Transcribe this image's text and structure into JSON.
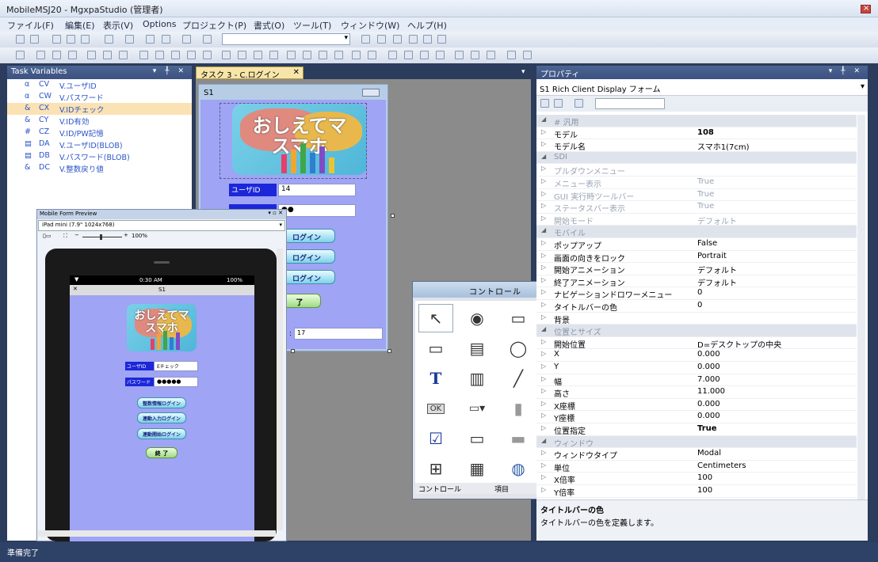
{
  "window": {
    "title": "MobileMSJ20 - MgxpaStudio (管理者)",
    "close": "×"
  },
  "menu": [
    "ファイル(F)",
    "編集(E)",
    "表示(V)",
    "Options",
    "プロジェクト(P)",
    "書式(O)",
    "ツール(T)",
    "ウィンドウ(W)",
    "ヘルプ(H)"
  ],
  "status": "準備完了",
  "task_vars": {
    "title": "Task Variables",
    "controls": "▾ ╀ ✕",
    "rows": [
      {
        "icon": "α",
        "id": "CV",
        "name": "V.ユーザID"
      },
      {
        "icon": "α",
        "id": "CW",
        "name": "V.パスワード"
      },
      {
        "icon": "&",
        "id": "CX",
        "name": "V.IDチェック",
        "selected": true
      },
      {
        "icon": "&",
        "id": "CY",
        "name": "V.ID有効"
      },
      {
        "icon": "#",
        "id": "CZ",
        "name": "V.ID/PW記憶"
      },
      {
        "icon": "▤",
        "id": "DA",
        "name": "V.ユーザID(BLOB)"
      },
      {
        "icon": "▤",
        "id": "DB",
        "name": "V.パスワード(BLOB)"
      },
      {
        "icon": "&",
        "id": "DC",
        "name": "V.整数戻り値"
      }
    ]
  },
  "doc_tab": {
    "label": "タスク 3 - C.ログイン",
    "close": "✕"
  },
  "form": {
    "caption": "S1",
    "logo_l1": "おしえてマ",
    "logo_l2": "スマホ",
    "user_label": "ユーザID",
    "user_value": "14",
    "pass_mask": "●●",
    "btn1": "ログイン",
    "btn2": "ログイン",
    "btn3": "ログイン",
    "btn_exit": "了",
    "bottom_value": "17",
    "bottom_prefix": ":"
  },
  "preview": {
    "title": "Mobile Form Preview",
    "device": "iPad mini (7.9\" 1024x768)",
    "zoom": "100%",
    "time": "0:30 AM",
    "battery": "100%",
    "caption": "S1",
    "close": "✕",
    "user_label": "ユーザID",
    "user_value": "Eチェック",
    "pass_label": "パスワード",
    "pass_value": "●●●●●",
    "btn1": "整数情報ログイン",
    "btn2": "連動入力ログイン",
    "btn3": "連動開始ログイン",
    "btn_exit": "終 了"
  },
  "props": {
    "title": "プロパティ",
    "controls": "▾ ╀ ✕",
    "object": "S1 Rich Client Display フォーム",
    "rows": [
      {
        "k": "# 汎用",
        "v": "",
        "cat": true
      },
      {
        "k": "モデル",
        "v": "108",
        "bold": true
      },
      {
        "k": "モデル名",
        "v": "スマホ1(7cm)"
      },
      {
        "k": "SDI",
        "v": "",
        "cat": true
      },
      {
        "k": "プルダウンメニュー",
        "v": "",
        "dim": true
      },
      {
        "k": "メニュー表示",
        "v": "True",
        "dim": true
      },
      {
        "k": "GUI 実行時ツールバー",
        "v": "True",
        "dim": true
      },
      {
        "k": "ステータスバー表示",
        "v": "True",
        "dim": true
      },
      {
        "k": "開始モード",
        "v": "デフォルト",
        "dim": true
      },
      {
        "k": "モバイル",
        "v": "",
        "cat": true
      },
      {
        "k": "ポップアップ",
        "v": "False"
      },
      {
        "k": "画面の向きをロック",
        "v": "Portrait"
      },
      {
        "k": "開始アニメーション",
        "v": "デフォルト"
      },
      {
        "k": "終了アニメーション",
        "v": "デフォルト"
      },
      {
        "k": "ナビゲーションドロワーメニュー",
        "v": "0"
      },
      {
        "k": "タイトルバーの色",
        "v": "0"
      },
      {
        "k": "背景",
        "v": ""
      },
      {
        "k": "位置とサイズ",
        "v": "",
        "cat": true
      },
      {
        "k": "開始位置",
        "v": "D=デスクトップの中央"
      },
      {
        "k": "X",
        "v": "0.000"
      },
      {
        "k": "Y",
        "v": "0.000"
      },
      {
        "k": "幅",
        "v": "7.000"
      },
      {
        "k": "高さ",
        "v": "11.000"
      },
      {
        "k": "X座標",
        "v": "0.000"
      },
      {
        "k": "Y座標",
        "v": "0.000"
      },
      {
        "k": "位置指定",
        "v": "True",
        "bold": true
      },
      {
        "k": "ウィンドウ",
        "v": "",
        "cat": true
      },
      {
        "k": "ウィンドウタイプ",
        "v": "Modal"
      },
      {
        "k": "単位",
        "v": "Centimeters"
      },
      {
        "k": "X倍率",
        "v": "100"
      },
      {
        "k": "Y倍率",
        "v": "100"
      }
    ],
    "desc_title": "タイトルバーの色",
    "desc_text": "タイトルバーの色を定義します。"
  },
  "palette": {
    "title": "コントロール",
    "tab1": "コントロール",
    "tab2": "項目",
    "items": [
      "pointer",
      "radio",
      "rectangle",
      "table",
      "edit",
      "tab",
      "ellipse",
      "image",
      "text",
      "subform",
      "line",
      "group",
      "button",
      "combo",
      "slider",
      "rich-text",
      "checkbox",
      "frame",
      "divider",
      "rich-edit",
      "tree",
      "grid",
      "browser",
      "dotnet"
    ]
  }
}
